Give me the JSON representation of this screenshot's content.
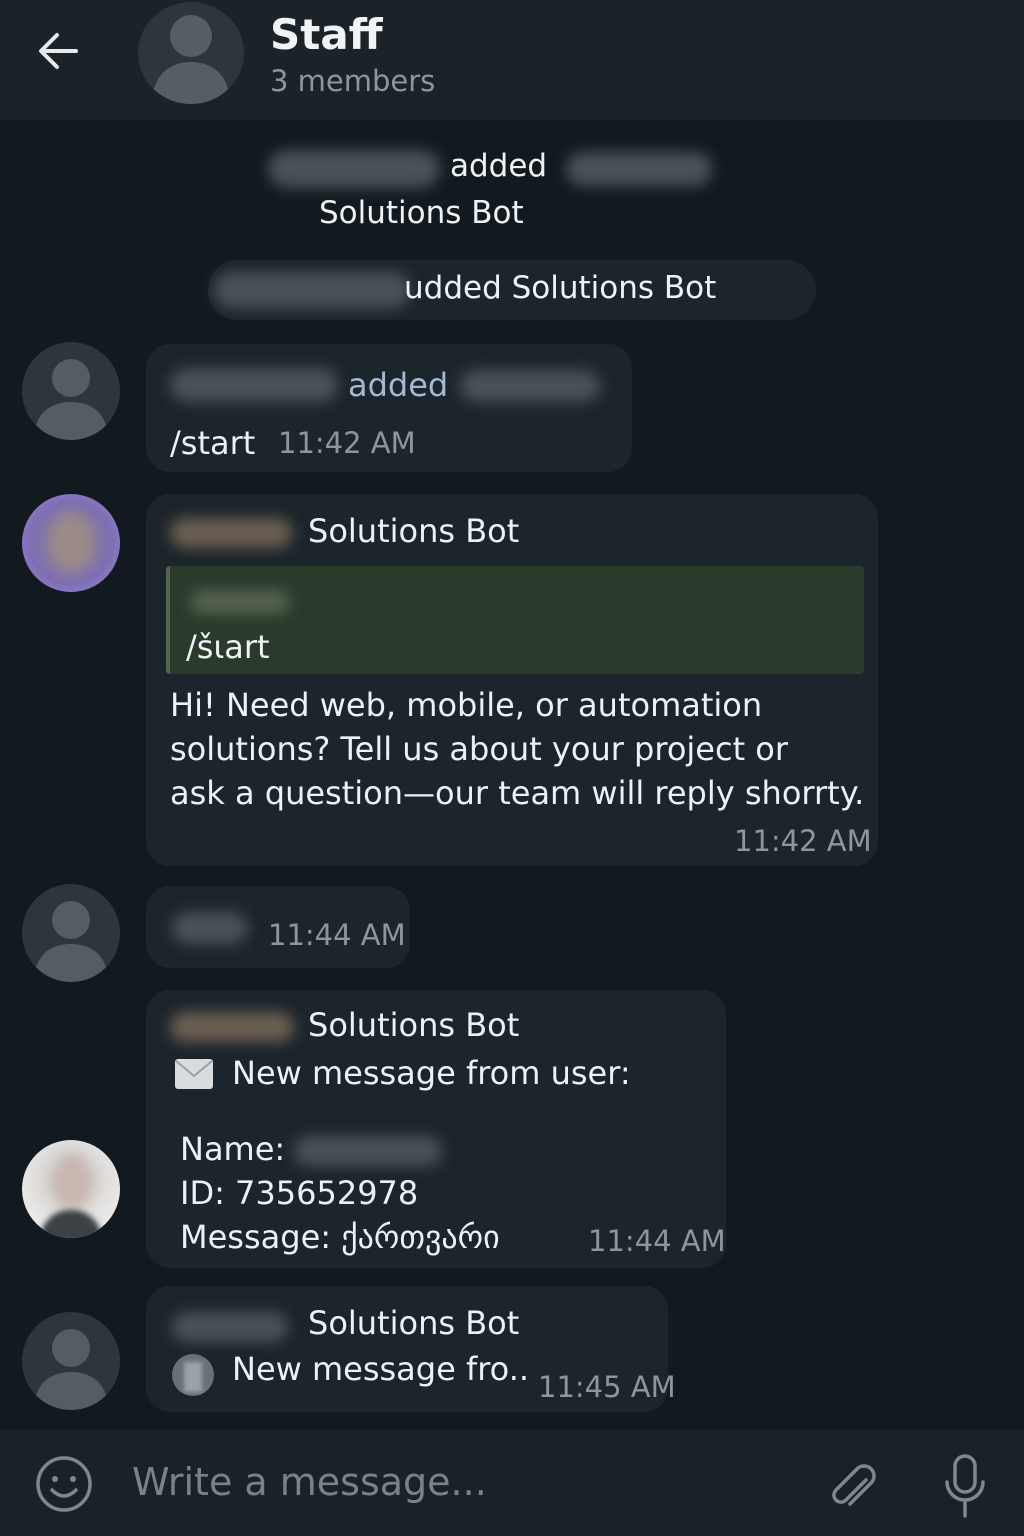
{
  "header": {
    "title": "Staff",
    "subtitle": "3 members"
  },
  "service": {
    "msg1_verb": "added",
    "msg1_object": "Solutions Bot",
    "msg2_text": "udded Solutions Bot"
  },
  "messages": {
    "m1": {
      "verb": "added",
      "text": "/start",
      "time": "11:42 AM"
    },
    "m2": {
      "sender": "Solutions Bot",
      "quote": "/šιart",
      "lines": [
        "Hi! Need web, mobile, or automation",
        "solutions? Tell us about your project or",
        "ask a question—our team will reply shorrty."
      ],
      "time": "11:42 AM"
    },
    "m3": {
      "time": "11:44 AM"
    },
    "m4": {
      "sender": "Solutions Bot",
      "heading": "New message from user:",
      "name_label": "Name:",
      "id_line": "ID: 735652978",
      "message_line": "Message: ქართვარი",
      "time": "11:44 AM"
    },
    "m5": {
      "sender": "Solutions Bot",
      "text": "New message fro..",
      "time": "11:45 AM"
    }
  },
  "input": {
    "placeholder": "Write a message..."
  },
  "icons": {
    "back": "arrow-left-icon",
    "emoji": "smile-icon",
    "attach": "paperclip-icon",
    "mic": "microphone-icon",
    "envelope": "envelope-icon"
  },
  "colors": {
    "background": "#121a1f",
    "bubble": "#1c252b",
    "quote": "#2a3a2b",
    "sender_gold": "#d7c0a0",
    "sender_blue": "#a6b8d4"
  }
}
